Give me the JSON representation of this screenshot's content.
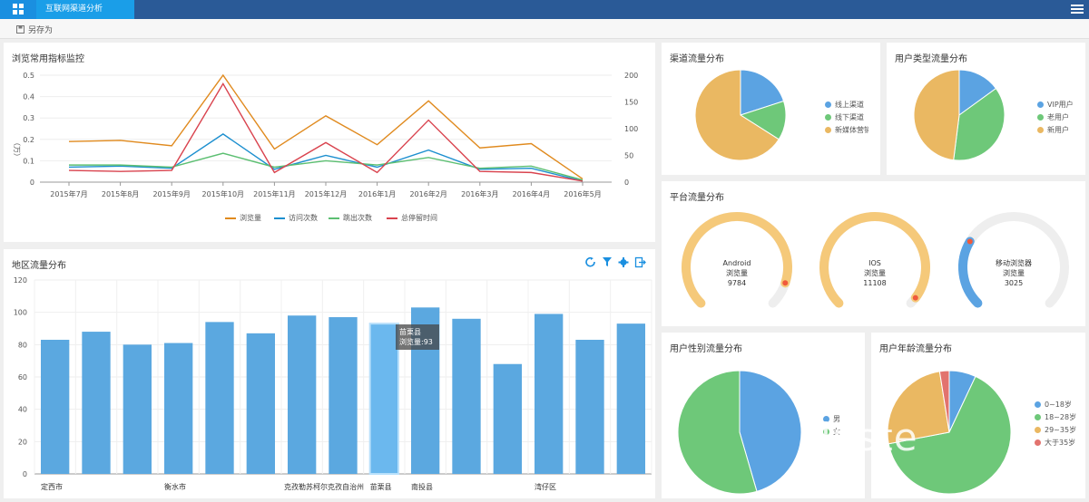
{
  "app": {
    "tab_title": "互联网渠道分析"
  },
  "toolbar": {
    "save_label": "另存为"
  },
  "line_panel": {
    "title": "浏览常用指标监控",
    "y_unit": "（万）",
    "legend": [
      {
        "name": "浏览量",
        "color": "#e08a1e"
      },
      {
        "name": "访问次数",
        "color": "#1c8fcf"
      },
      {
        "name": "跳出次数",
        "color": "#5cbf72"
      },
      {
        "name": "总停留时间",
        "color": "#d9434e"
      }
    ]
  },
  "bar_panel": {
    "title": "地区流量分布",
    "tooltip": {
      "name": "苗栗县",
      "line": "浏览量:93"
    }
  },
  "channel_panel": {
    "title": "渠道流量分布",
    "legend": [
      {
        "name": "线上渠道",
        "color": "#5ba3e2"
      },
      {
        "name": "线下渠道",
        "color": "#6ec879"
      },
      {
        "name": "新媒体营销",
        "color": "#eab862"
      }
    ]
  },
  "usertype_panel": {
    "title": "用户类型流量分布",
    "legend": [
      {
        "name": "VIP用户",
        "color": "#5ba3e2"
      },
      {
        "name": "老用户",
        "color": "#6ec879"
      },
      {
        "name": "新用户",
        "color": "#eab862"
      }
    ]
  },
  "platform_panel": {
    "title": "平台流量分布",
    "gauges": [
      {
        "name": "Android",
        "label": "浏览量",
        "value": "9784",
        "color": "#f5c97a",
        "fraction": 0.9
      },
      {
        "name": "IOS",
        "label": "浏览量",
        "value": "11108",
        "color": "#f5c97a",
        "fraction": 0.97
      },
      {
        "name": "移动浏览器",
        "label": "浏览量",
        "value": "3025",
        "color": "#5ba3e2",
        "fraction": 0.28
      }
    ]
  },
  "gender_panel": {
    "title": "用户性别流量分布",
    "legend": [
      {
        "name": "男",
        "color": "#5ba3e2"
      },
      {
        "name": "女",
        "color": "#6ec879"
      }
    ]
  },
  "age_panel": {
    "title": "用户年龄流量分布",
    "legend": [
      {
        "name": "0~18岁",
        "color": "#5ba3e2"
      },
      {
        "name": "18~28岁",
        "color": "#6ec879"
      },
      {
        "name": "29~35岁",
        "color": "#eab862"
      },
      {
        "name": "大于35岁",
        "color": "#e2736e"
      }
    ]
  },
  "watermark": "cluste",
  "chart_data": [
    {
      "type": "line",
      "title": "浏览常用指标监控",
      "ylabel": "（万）",
      "categories": [
        "2015年7月",
        "2015年8月",
        "2015年9月",
        "2015年10月",
        "2015年11月",
        "2015年12月",
        "2016年1月",
        "2016年2月",
        "2016年3月",
        "2016年4月",
        "2016年5月"
      ],
      "ylim": [
        0,
        0.5
      ],
      "yticks": [
        "0",
        "0.1",
        "0.2",
        "0.3",
        "0.4",
        "0.5"
      ],
      "y2lim": [
        0,
        200
      ],
      "y2ticks": [
        "0",
        "50",
        "100",
        "150",
        "200"
      ],
      "series": [
        {
          "name": "浏览量",
          "values": [
            0.19,
            0.195,
            0.17,
            0.5,
            0.155,
            0.31,
            0.175,
            0.38,
            0.16,
            0.18,
            0.015
          ]
        },
        {
          "name": "访问次数",
          "values": [
            0.07,
            0.075,
            0.065,
            0.225,
            0.06,
            0.125,
            0.07,
            0.15,
            0.06,
            0.065,
            0.005
          ]
        },
        {
          "name": "跳出次数",
          "values": [
            0.08,
            0.08,
            0.07,
            0.135,
            0.07,
            0.1,
            0.08,
            0.115,
            0.065,
            0.075,
            0.01
          ]
        },
        {
          "name": "总停留时间",
          "values": [
            0.055,
            0.05,
            0.055,
            0.46,
            0.045,
            0.185,
            0.045,
            0.29,
            0.05,
            0.045,
            0.005
          ]
        }
      ]
    },
    {
      "type": "bar",
      "title": "地区流量分布",
      "ylim": [
        0,
        120
      ],
      "yticks": [
        "0",
        "20",
        "40",
        "60",
        "80",
        "100",
        "120"
      ],
      "categories": [
        "定西市",
        "",
        "",
        "衡水市",
        "",
        "",
        "克孜勒苏柯尔克孜自治州",
        "",
        "苗栗县",
        "南投县",
        "",
        "",
        "湾仔区",
        "",
        ""
      ],
      "values": [
        83,
        88,
        80,
        81,
        94,
        87,
        98,
        97,
        93,
        103,
        96,
        68,
        99,
        83,
        93
      ],
      "highlight_index": 8
    },
    {
      "type": "pie",
      "title": "渠道流量分布",
      "labels": [
        "线上渠道",
        "线下渠道",
        "新媒体营销"
      ],
      "values": [
        20,
        14,
        66
      ]
    },
    {
      "type": "pie",
      "title": "用户类型流量分布",
      "labels": [
        "VIP用户",
        "老用户",
        "新用户"
      ],
      "values": [
        15,
        37,
        48
      ]
    },
    {
      "type": "pie",
      "title": "用户性别流量分布",
      "labels": [
        "男",
        "女"
      ],
      "values": [
        45.5,
        54.5
      ]
    },
    {
      "type": "pie",
      "title": "用户年龄流量分布",
      "labels": [
        "0~18岁",
        "18~28岁",
        "29~35岁",
        "大于35岁"
      ],
      "values": [
        7,
        65,
        25.5,
        2.5
      ]
    }
  ]
}
